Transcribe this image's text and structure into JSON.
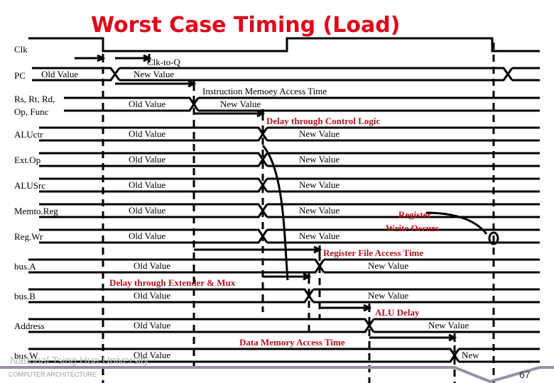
{
  "title": "Worst Case Timing (Load)",
  "signals": [
    {
      "name": "Clk"
    },
    {
      "name": "PC",
      "old": "Old Value",
      "new": "New Value"
    },
    {
      "name": "Rs, Rt, Rd,",
      "name2": "Op, Func",
      "old": "Old Value",
      "new": "New Value"
    },
    {
      "name": "ALUctr",
      "old": "Old Value",
      "new": "New Value"
    },
    {
      "name": "Ext.Op",
      "old": "Old Value",
      "new": "New Value"
    },
    {
      "name": "ALUSrc",
      "old": "Old Value",
      "new": "New Value"
    },
    {
      "name": "Memto.Reg",
      "old": "Old Value",
      "new": "New Value"
    },
    {
      "name": "Reg.Wr",
      "old": "Old Value",
      "new": "New Value"
    },
    {
      "name": "bus.A",
      "old": "Old Value",
      "new": "New Value"
    },
    {
      "name": "bus.B",
      "old": "Old Value",
      "new": "New Value"
    },
    {
      "name": "Address",
      "old": "Old Value",
      "new": "New Value"
    },
    {
      "name": "bus.W",
      "old": "Old Value",
      "new": "New"
    }
  ],
  "annotations": {
    "clk_to_q": "Clk-to-Q",
    "imem": "Instruction Memoey Access Time",
    "control": "Delay through Control Logic",
    "reg_write_1": "Register",
    "reg_write_2": "Write Occurs",
    "regfile": "Register File Access Time",
    "extender": "Delay through Extender & Mux",
    "alu": "ALU Delay",
    "dmem": "Data Memory Access Time"
  },
  "colors": {
    "title": "#e0001a",
    "annotation": "#b5121b",
    "footer_bar": "#9a8fa6"
  },
  "footer": {
    "university": "National Tsing Hua University",
    "course": "COMPUTER ARCHITECTURE",
    "page": "67"
  }
}
